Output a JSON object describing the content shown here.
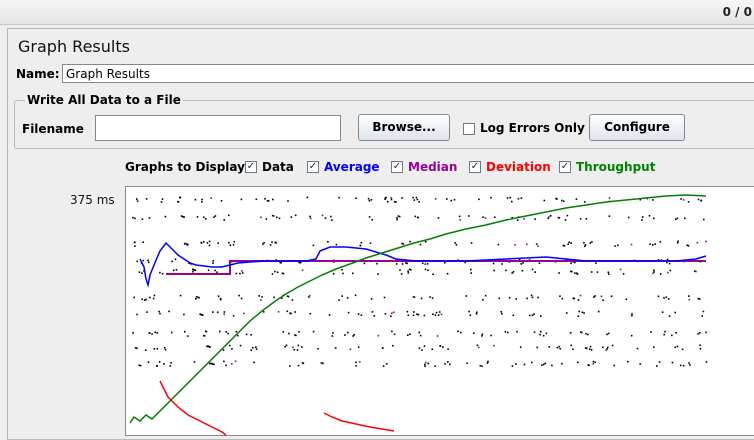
{
  "toolbar": {
    "counter": "0 / 0"
  },
  "panel": {
    "title": "Graph Results",
    "name_label": "Name:",
    "name_value": "Graph Results"
  },
  "file_group": {
    "legend": "Write All Data to a File",
    "filename_label": "Filename",
    "filename_value": "",
    "browse_label": "Browse...",
    "log_errors_label": "Log Errors Only",
    "log_errors_checked": false,
    "configure_label": "Configure"
  },
  "graphs_to_display": {
    "label": "Graphs to Display",
    "options": [
      {
        "label": "Data",
        "checked": true,
        "color": "#000000"
      },
      {
        "label": "Average",
        "checked": true,
        "color": "#0000ff"
      },
      {
        "label": "Median",
        "checked": true,
        "color": "#990099"
      },
      {
        "label": "Deviation",
        "checked": true,
        "color": "#ff0000"
      },
      {
        "label": "Throughput",
        "checked": true,
        "color": "#008000"
      }
    ]
  },
  "graph": {
    "y_max_label": "375  ms"
  }
}
